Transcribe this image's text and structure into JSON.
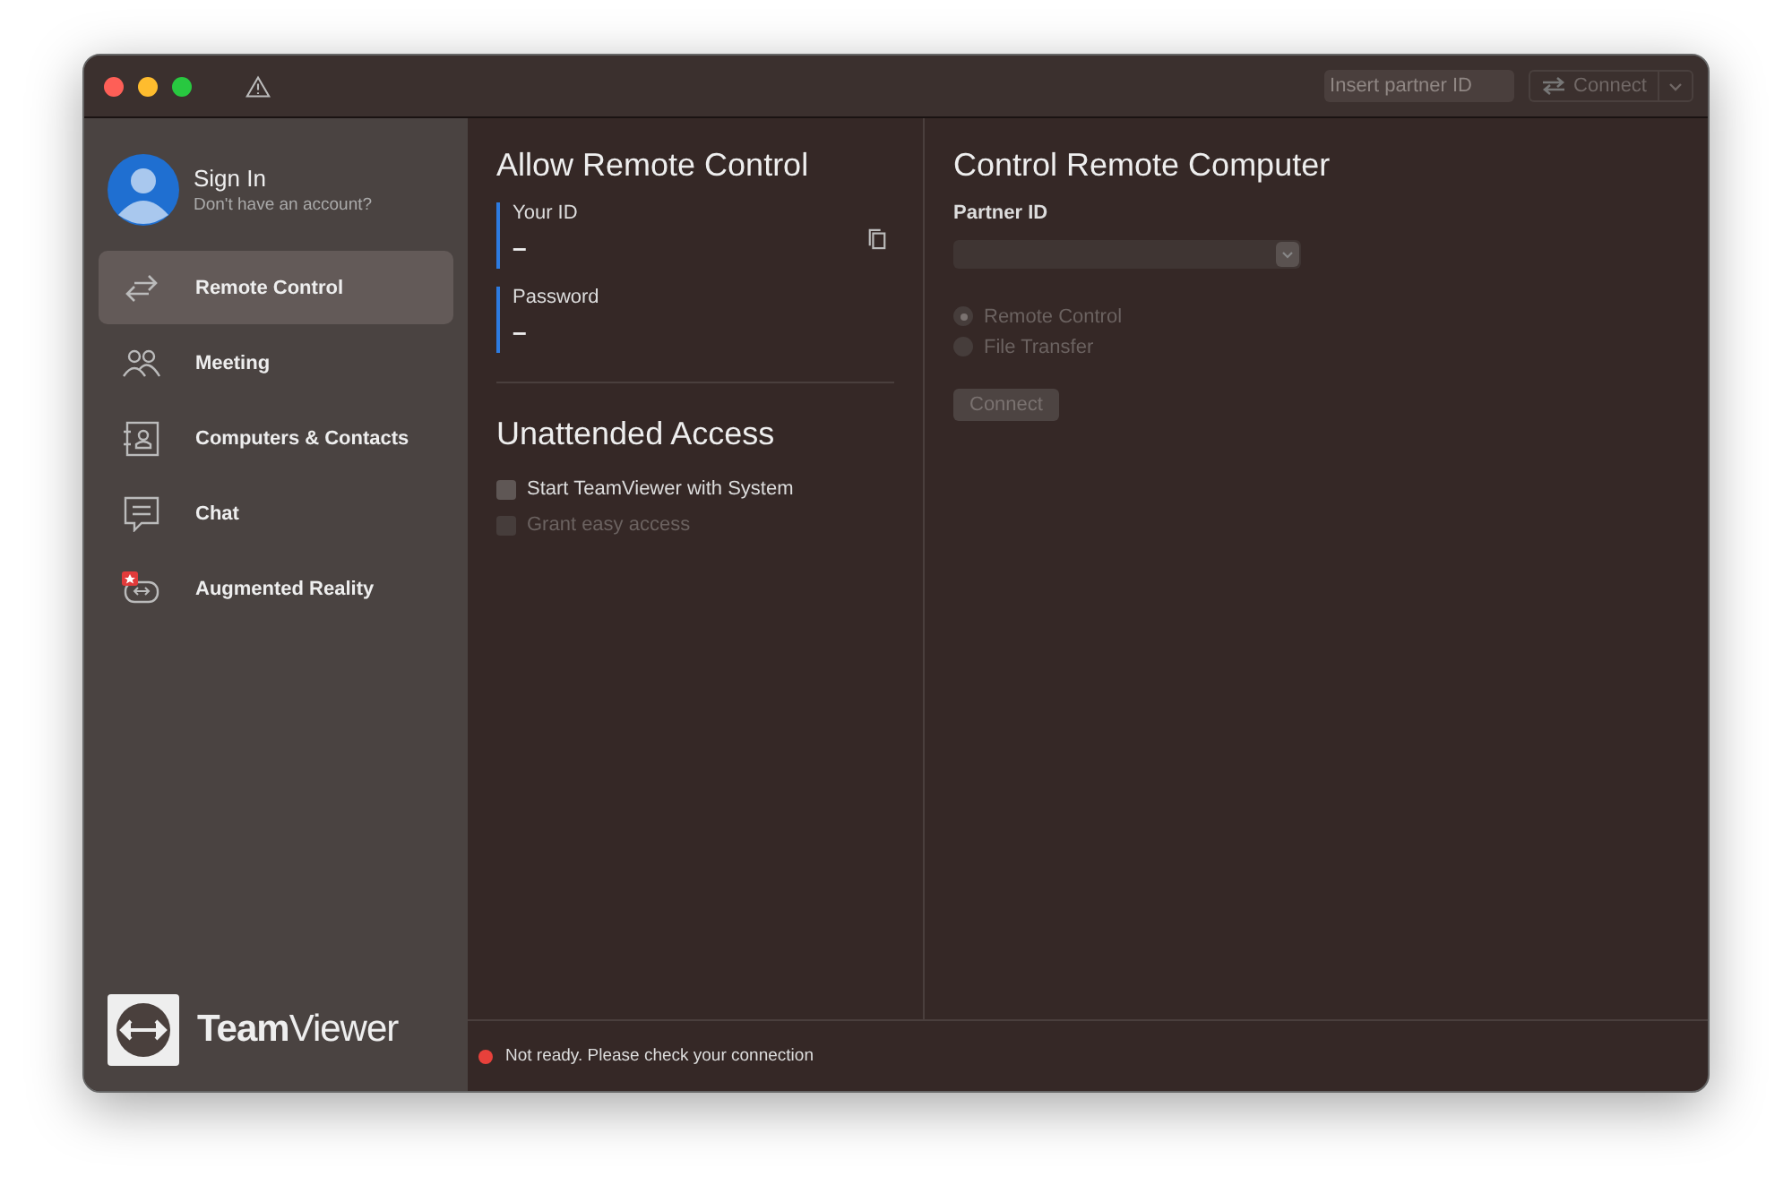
{
  "toolbar": {
    "partner_placeholder": "Insert partner ID",
    "connect_label": "Connect"
  },
  "account": {
    "title": "Sign In",
    "subtitle": "Don't have an account?"
  },
  "sidebar": {
    "items": [
      {
        "kind": "remote",
        "label": "Remote Control",
        "selected": true
      },
      {
        "kind": "meeting",
        "label": "Meeting",
        "selected": false
      },
      {
        "kind": "contacts",
        "label": "Computers & Contacts",
        "selected": false
      },
      {
        "kind": "chat",
        "label": "Chat",
        "selected": false
      },
      {
        "kind": "ar",
        "label": "Augmented Reality",
        "selected": false
      }
    ],
    "logo": "**Team**Viewer"
  },
  "allow": {
    "title": "Allow Remote Control",
    "fields": [
      {
        "label": "Your ID",
        "value": "–",
        "copy": true
      },
      {
        "label": "Password",
        "value": "–",
        "copy": false
      }
    ]
  },
  "unattended": {
    "title": "Unattended Access",
    "options": [
      {
        "label": "Start TeamViewer with System",
        "checked": false,
        "disabled": false
      },
      {
        "label": "Grant easy access",
        "checked": false,
        "disabled": true
      }
    ]
  },
  "control": {
    "title": "Control Remote Computer",
    "partner_label": "Partner ID",
    "modes": [
      {
        "label": "Remote Control",
        "selected": true
      },
      {
        "label": "File Transfer",
        "selected": false
      }
    ],
    "connect": "Connect"
  },
  "status": {
    "text": "Not ready. Please check your connection",
    "color": "#e8413b"
  }
}
